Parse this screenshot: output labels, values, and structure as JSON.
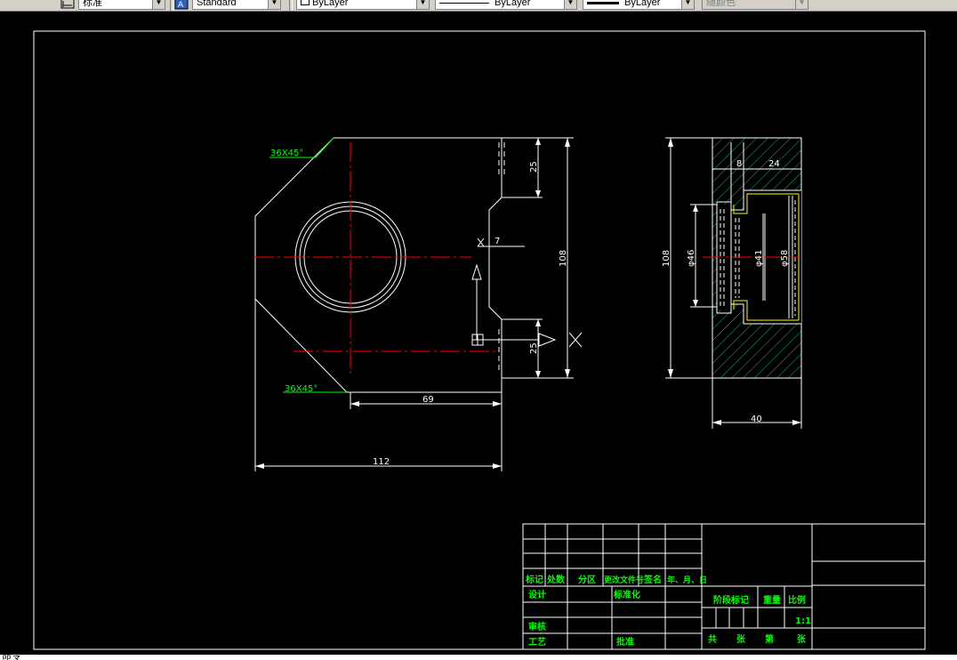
{
  "toolbar": {
    "dim_style": "标准",
    "text_style": "Standard",
    "layer": "ByLayer",
    "linetype": "ByLayer",
    "lineweight": "ByLayer",
    "color": "随颜色"
  },
  "drawing": {
    "dims": {
      "chamfer_top": "36X45°",
      "chamfer_bottom": "36X45°",
      "d25_top": "25",
      "d7": "7",
      "d108_front": "108",
      "d25_bottom": "25",
      "d69": "69",
      "d112": "112",
      "d8": "8",
      "d24": "24",
      "d108_side": "108",
      "d46": "φ46",
      "d41": "φ41",
      "d58": "φ58",
      "d40": "40"
    }
  },
  "title_block": {
    "mark": "标记",
    "qty": "处数",
    "zone": "分区",
    "change_doc": "更改文件号",
    "sign": "签名",
    "date": "年、月、日",
    "design": "设计",
    "standardize": "标准化",
    "stage_mark": "阶段标记",
    "weight": "重量",
    "scale": "比例",
    "review": "审核",
    "process": "工艺",
    "approve": "批准",
    "scale_value": "1:1",
    "total": "共",
    "sheet1": "张",
    "page": "第",
    "sheet2": "张"
  },
  "command_line": "命令"
}
